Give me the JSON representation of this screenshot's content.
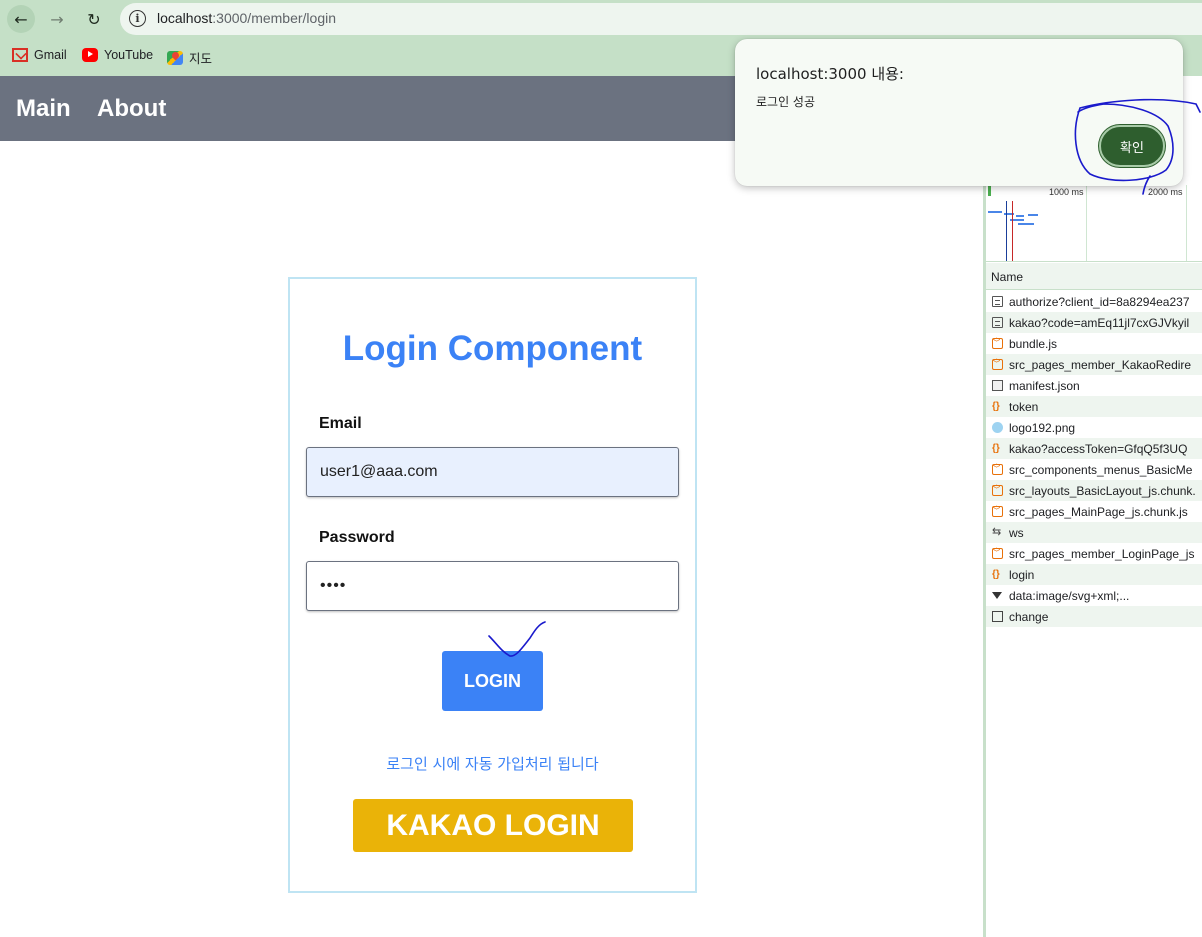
{
  "browser": {
    "back_icon": "arrow-left-icon",
    "forward_icon": "arrow-right-icon",
    "reload_icon": "reload-icon",
    "url_host": "localhost",
    "url_path": ":3000/member/login",
    "bookmarks": [
      {
        "label": "Gmail",
        "icon": "gmail-icon"
      },
      {
        "label": "YouTube",
        "icon": "youtube-icon"
      },
      {
        "label": "지도",
        "icon": "maps-icon"
      }
    ]
  },
  "app_nav": {
    "items": [
      {
        "label": "Main"
      },
      {
        "label": "About"
      }
    ]
  },
  "login": {
    "title": "Login Component",
    "email_label": "Email",
    "email_value": "user1@aaa.com",
    "password_label": "Password",
    "password_value": "••••",
    "login_button": "LOGIN",
    "auto_signup_message": "로그인 시에 자동 가입처리 됩니다",
    "kakao_button": "KAKAO LOGIN",
    "colors": {
      "title": "#3b82f6",
      "login_button": "#3b82f6",
      "kakao_button": "#eab308",
      "card_border": "#bfe4f3"
    }
  },
  "devtools": {
    "timeline_labels": [
      "1000 ms",
      "2000 ms"
    ],
    "column_header": "Name",
    "requests": [
      {
        "name": "authorize?client_id=8a8294ea237",
        "icon": "document-icon"
      },
      {
        "name": "kakao?code=amEq11jl7cxGJVkyil",
        "icon": "document-icon"
      },
      {
        "name": "bundle.js",
        "icon": "script-icon"
      },
      {
        "name": "src_pages_member_KakaoRedire",
        "icon": "script-icon"
      },
      {
        "name": "manifest.json",
        "icon": "manifest-icon"
      },
      {
        "name": "token",
        "icon": "fetch-icon"
      },
      {
        "name": "logo192.png",
        "icon": "image-icon"
      },
      {
        "name": "kakao?accessToken=GfqQ5f3UQ",
        "icon": "fetch-icon"
      },
      {
        "name": "src_components_menus_BasicMe",
        "icon": "script-icon"
      },
      {
        "name": "src_layouts_BasicLayout_js.chunk.",
        "icon": "script-icon"
      },
      {
        "name": "src_pages_MainPage_js.chunk.js",
        "icon": "script-icon"
      },
      {
        "name": "ws",
        "icon": "websocket-icon"
      },
      {
        "name": "src_pages_member_LoginPage_js",
        "icon": "script-icon"
      },
      {
        "name": "login",
        "icon": "fetch-icon"
      },
      {
        "name": "data:image/svg+xml;...",
        "icon": "expand-triangle-icon"
      },
      {
        "name": "change",
        "icon": "checkbox-icon"
      }
    ]
  },
  "dialog": {
    "title": "localhost:3000 내용:",
    "message": "로그인 성공",
    "ok_button": "확인",
    "ok_color": "#2e5e2e"
  },
  "annotation_color": "#1a1acc"
}
